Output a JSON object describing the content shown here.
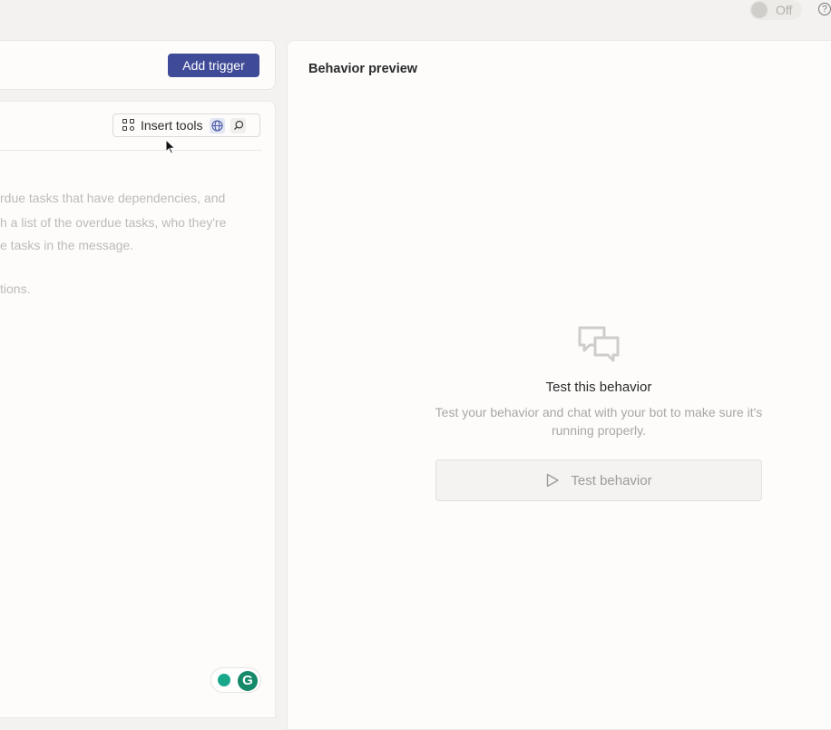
{
  "status_toggle": {
    "label": "Off",
    "state": "off"
  },
  "header": {
    "help_icon": "question-circle-icon"
  },
  "trigger_card": {
    "add_trigger_label": "Add trigger",
    "button_color": "#3f4b97"
  },
  "editor": {
    "insert_tools_label": "Insert tools",
    "icons": [
      "insert-tools-icon",
      "globe-icon",
      "search-icon"
    ],
    "prompt_lines": [
      "rdue tasks that have dependencies, and",
      "h a list of the overdue tasks, who they're",
      "e tasks in the message.",
      "",
      "tions."
    ]
  },
  "preview": {
    "title": "Behavior preview",
    "empty_state": {
      "icon": "chat-bubbles-icon",
      "heading": "Test this behavior",
      "description_line1": "Test your behavior and chat with your bot to make sure it's",
      "description_line2": "running properly.",
      "button_label": "Test behavior",
      "button_icon": "play-icon"
    }
  },
  "extensions": {
    "grammarly_icon": "grammarly-icon",
    "grammarly_letter": "G",
    "suggestion_icon": "lightbulb-icon"
  }
}
